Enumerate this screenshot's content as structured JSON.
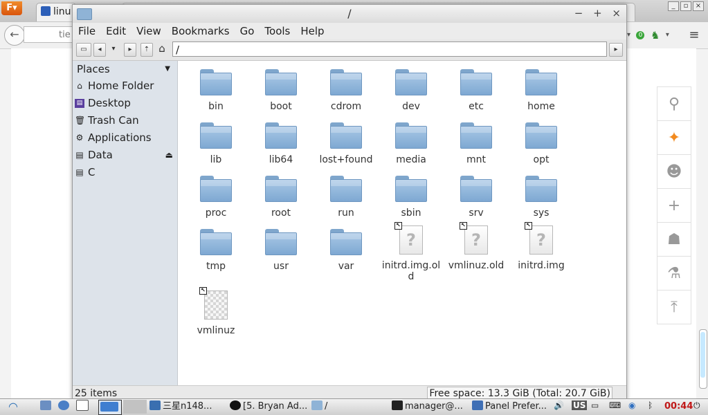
{
  "browser": {
    "tab_title": "linu",
    "url_fragment": "tie"
  },
  "window": {
    "title": "/",
    "minimize": "−",
    "maximize": "+",
    "close": "×"
  },
  "menu": [
    "File",
    "Edit",
    "View",
    "Bookmarks",
    "Go",
    "Tools",
    "Help"
  ],
  "toolbar": {
    "path": "/"
  },
  "sidebar": {
    "heading": "Places",
    "items": [
      {
        "label": "Home Folder",
        "icon": "home-icon"
      },
      {
        "label": "Desktop",
        "icon": "desktop-icon"
      },
      {
        "label": "Trash Can",
        "icon": "trash-icon"
      },
      {
        "label": "Applications",
        "icon": "applications-icon"
      },
      {
        "label": "Data",
        "icon": "drive-icon"
      },
      {
        "label": "C",
        "icon": "drive-icon"
      }
    ]
  },
  "files": [
    {
      "name": "bin",
      "type": "folder"
    },
    {
      "name": "boot",
      "type": "folder"
    },
    {
      "name": "cdrom",
      "type": "folder"
    },
    {
      "name": "dev",
      "type": "folder"
    },
    {
      "name": "etc",
      "type": "folder"
    },
    {
      "name": "home",
      "type": "folder"
    },
    {
      "name": "lib",
      "type": "folder"
    },
    {
      "name": "lib64",
      "type": "folder"
    },
    {
      "name": "lost+found",
      "type": "folder"
    },
    {
      "name": "media",
      "type": "folder"
    },
    {
      "name": "mnt",
      "type": "folder"
    },
    {
      "name": "opt",
      "type": "folder"
    },
    {
      "name": "proc",
      "type": "folder"
    },
    {
      "name": "root",
      "type": "folder"
    },
    {
      "name": "run",
      "type": "folder"
    },
    {
      "name": "sbin",
      "type": "folder"
    },
    {
      "name": "srv",
      "type": "folder"
    },
    {
      "name": "sys",
      "type": "folder"
    },
    {
      "name": "tmp",
      "type": "folder"
    },
    {
      "name": "usr",
      "type": "folder"
    },
    {
      "name": "var",
      "type": "folder"
    },
    {
      "name": "initrd.img.old",
      "type": "link-unknown"
    },
    {
      "name": "vmlinuz.old",
      "type": "link-unknown"
    },
    {
      "name": "initrd.img",
      "type": "link-unknown"
    },
    {
      "name": "vmlinuz",
      "type": "link-image"
    }
  ],
  "status": {
    "items": "25 items",
    "free_space": "Free space: 13.3 GiB (Total: 20.7 GiB)"
  },
  "taskbar": {
    "tasks": [
      "三星n148...",
      "[5. Bryan Ad...",
      "/",
      "manager@...",
      "Panel Prefer..."
    ],
    "keyboard_layout": "US",
    "clock": "00:44"
  }
}
